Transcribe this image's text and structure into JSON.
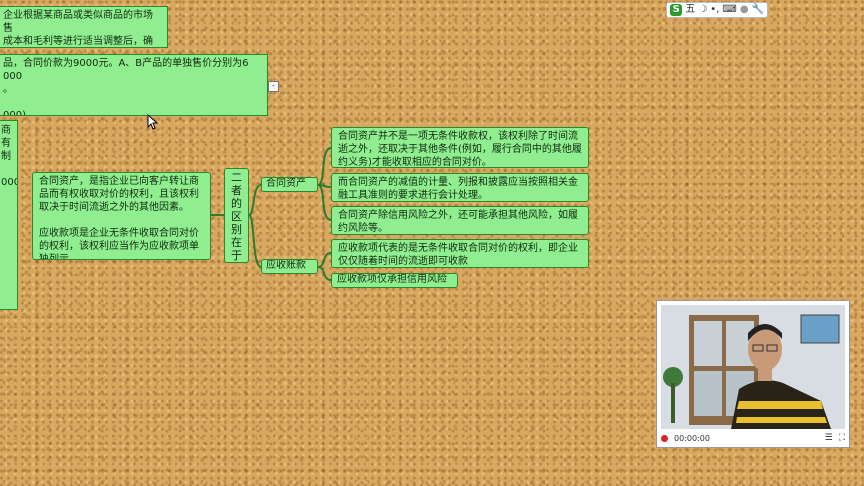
{
  "ime_toolbar": {
    "logo": "S",
    "mode_char": "五",
    "icons": [
      "moon-icon",
      "punctuation-icon",
      "keyboard-icon",
      "user-icon",
      "wrench-icon"
    ]
  },
  "mindmap": {
    "top_left_node": "企业根据某商品或类似商品的市场售\n成本和毛利等进行适当调整后，确定\n。",
    "price_node": "品，合同价款为9000元。A、B产品的单独售价分别为6 000\n。\n\n000)\n000)",
    "left_edge_node": "商\n有\n制\n\n000",
    "definition_node": "合同资产，是指企业已向客户转让商品而有权收取对价的权利，且该权利取决于时间流逝之外的其他因素。\n\n应收款项是企业无条件收取合同对价的权利，该权利应当作为应收款项单独列示。",
    "center_node": "二\n者\n的\n区\n别\n在\n于",
    "branch_contract_asset": {
      "label": "合同资产",
      "leaves": [
        "合同资产并不是一项无条件收款权，该权利除了时间流逝之外，还取决于其他条件(例如，履行合同中的其他履约义务)才能收取相应的合同对价。",
        "而合同资产的减值的计量、列报和披露应当按照相关金融工具准则的要求进行会计处理。",
        "合同资产除信用风险之外，还可能承担其他风险，如履约风险等。"
      ]
    },
    "branch_receivable": {
      "label": "应收账款",
      "leaves": [
        "应收款项代表的是无条件收取合同对价的权利，即企业仅仅随着时间的流逝即可收款",
        "应收款项仅承担信用风险"
      ]
    }
  },
  "webcam": {
    "time": "00:00:00",
    "controls": [
      "record-icon",
      "list-icon",
      "fullscreen-icon"
    ]
  }
}
